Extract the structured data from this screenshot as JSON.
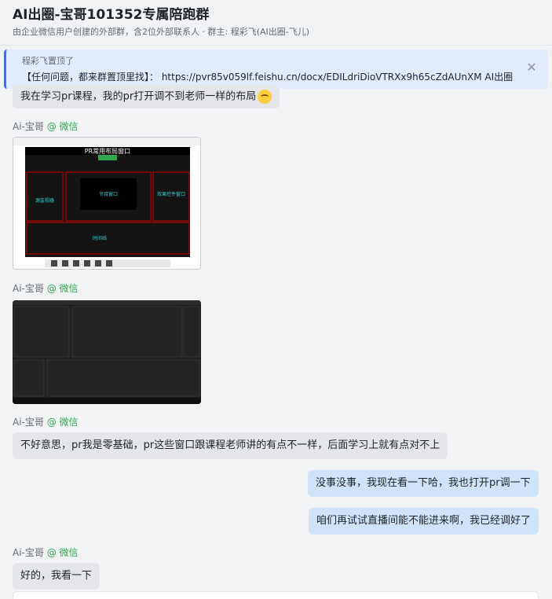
{
  "header": {
    "title": "AI出圈-宝哥101352专属陪跑群",
    "subtitle": "由企业微信用户创建的外部群，含2位外部联系人 · 群主: 程彩飞(AI出圈-飞儿)"
  },
  "pinned": {
    "who": "程彩飞置顶了",
    "message": "【任何问题，都来群置顶里找】： https://pvr85v059lf.feishu.cn/docx/EDILdriDioVTRXx9h65cZdAUnXM AI出圈 ..."
  },
  "messages": {
    "m1": "我在学习pr课程，我的pr打开调不到老师一样的布局",
    "sender_name": "Ai-宝哥",
    "sender_tag": "@ 微信",
    "img1": {
      "heading": "PR常用布局窗口",
      "center_label": "节目窗口",
      "left_label": "源监视器",
      "right_label": "效果控件窗口",
      "bottom_label": "时间线"
    },
    "m2": "不好意思，pr我是零基础，pr这些窗口跟课程老师讲的有点不一样，后面学习上就有点对不上",
    "m3": "没事没事，我现在看一下哈，我也打开pr调一下",
    "m4": "咱们再试试直播间能不能进来啊，我已经调好了",
    "m5": "好的，我看一下"
  },
  "colors": {
    "accent": "#3370ff",
    "wechat_tag": "#2fa84f",
    "bubble_left": "#e4e6ea",
    "bubble_right": "#cfe4fb"
  }
}
